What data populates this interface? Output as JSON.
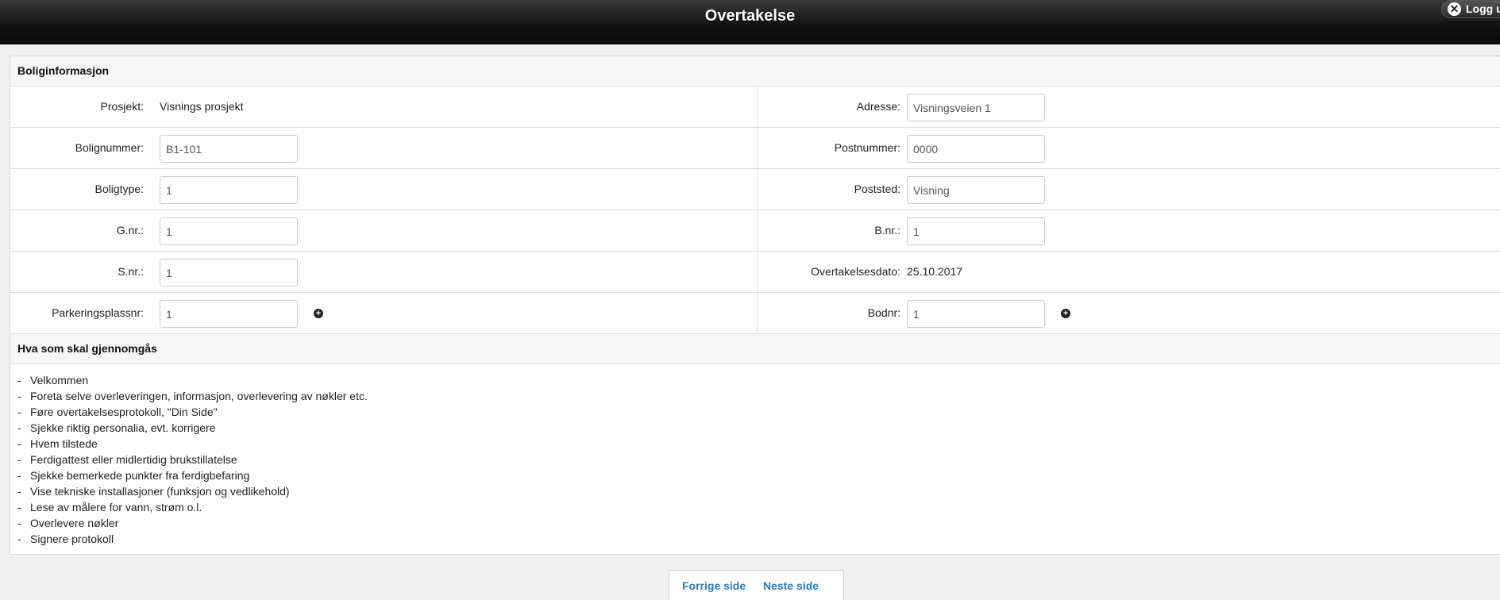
{
  "header": {
    "title": "Overtakelse",
    "logout_label": "Logg ut"
  },
  "boliginfo": {
    "heading": "Boliginformasjon",
    "rows": [
      {
        "left": {
          "label": "Prosjekt:",
          "value": "Visnings prosjekt"
        },
        "right": {
          "label": "Adresse:",
          "value": "Visningsveien 1"
        }
      },
      {
        "left": {
          "label": "Bolignummer:",
          "value": "B1-101"
        },
        "right": {
          "label": "Postnummer:",
          "value": "0000"
        }
      },
      {
        "left": {
          "label": "Boligtype:",
          "value": "1"
        },
        "right": {
          "label": "Poststed:",
          "value": "Visning"
        }
      },
      {
        "left": {
          "label": "G.nr.:",
          "value": "1"
        },
        "right": {
          "label": "B.nr.:",
          "value": "1"
        }
      },
      {
        "left": {
          "label": "S.nr.:",
          "value": "1"
        },
        "right": {
          "label": "Overtakelsesdato:",
          "value": "25.10.2017"
        }
      },
      {
        "left": {
          "label": "Parkeringsplassnr:",
          "value": "1"
        },
        "right": {
          "label": "Bodnr:",
          "value": "1"
        }
      }
    ]
  },
  "agenda": {
    "heading": "Hva som skal gjennomgås",
    "bullet": "-",
    "items": [
      "Velkommen",
      "Foreta selve overleveringen, informasjon, overlevering av nøkler etc.",
      "Føre overtakelsesprotokoll, \"Din Side\"",
      "Sjekke riktig personalia, evt. korrigere",
      "Hvem tilstede",
      "Ferdigattest eller midlertidig brukstillatelse",
      "Sjekke bemerkede punkter fra ferdigbefaring",
      "Vise tekniske installasjoner (funksjon og vedlikehold)",
      "Lese av målere for vann, strøm o.l.",
      "Overlevere nøkler",
      "Signere protokoll"
    ]
  },
  "pager": {
    "prev_label": "Forrige side",
    "next_label": "Neste side"
  },
  "icons": {
    "close": "close-icon",
    "add": "plus-circle-icon"
  }
}
